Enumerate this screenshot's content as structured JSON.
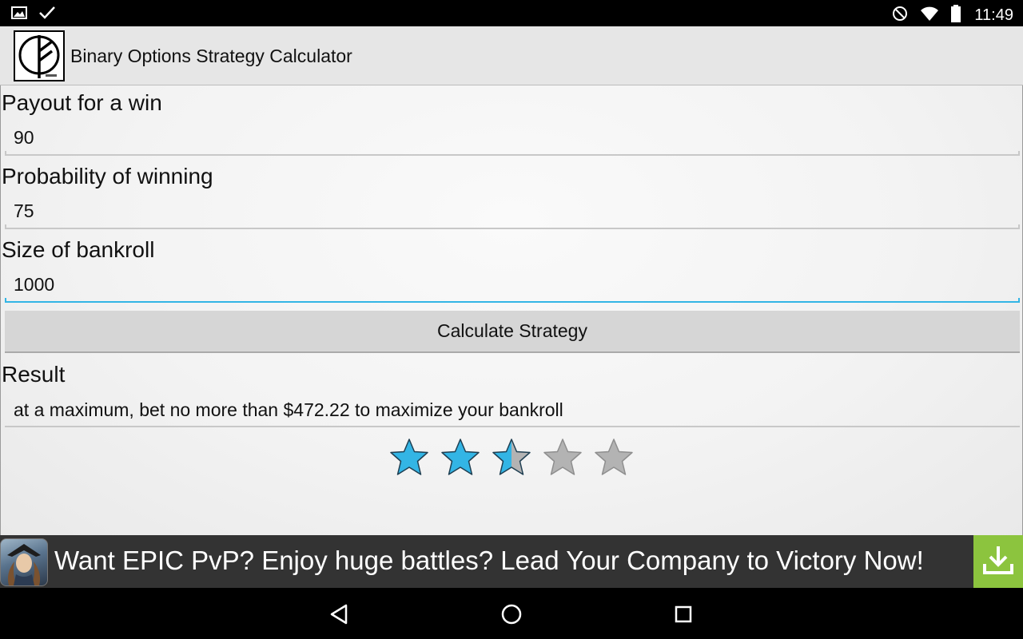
{
  "status_bar": {
    "time": "11:49",
    "left_icons": [
      "image-icon",
      "check-icon"
    ],
    "right_icons": [
      "blocked-icon",
      "wifi-icon",
      "battery-icon"
    ]
  },
  "app": {
    "title": "Binary Options Strategy Calculator"
  },
  "form": {
    "payout_label": "Payout for a win",
    "payout_value": "90",
    "probability_label": "Probability of winning",
    "probability_value": "75",
    "bankroll_label": "Size of bankroll",
    "bankroll_value": "1000",
    "calculate_label": "Calculate Strategy"
  },
  "result": {
    "label": "Result",
    "text": "at a maximum, bet no more than $472.22 to maximize your bankroll"
  },
  "rating": {
    "value": 2.5,
    "max": 5,
    "filled_color": "#33b5e5",
    "empty_color": "#b3b3b3"
  },
  "ad": {
    "text": "Want EPIC PvP? Enjoy huge battles? Lead Your Company to Victory Now!",
    "download_color": "#8cc43e"
  },
  "nav": {
    "buttons": [
      "back-icon",
      "home-icon",
      "recents-icon"
    ]
  }
}
